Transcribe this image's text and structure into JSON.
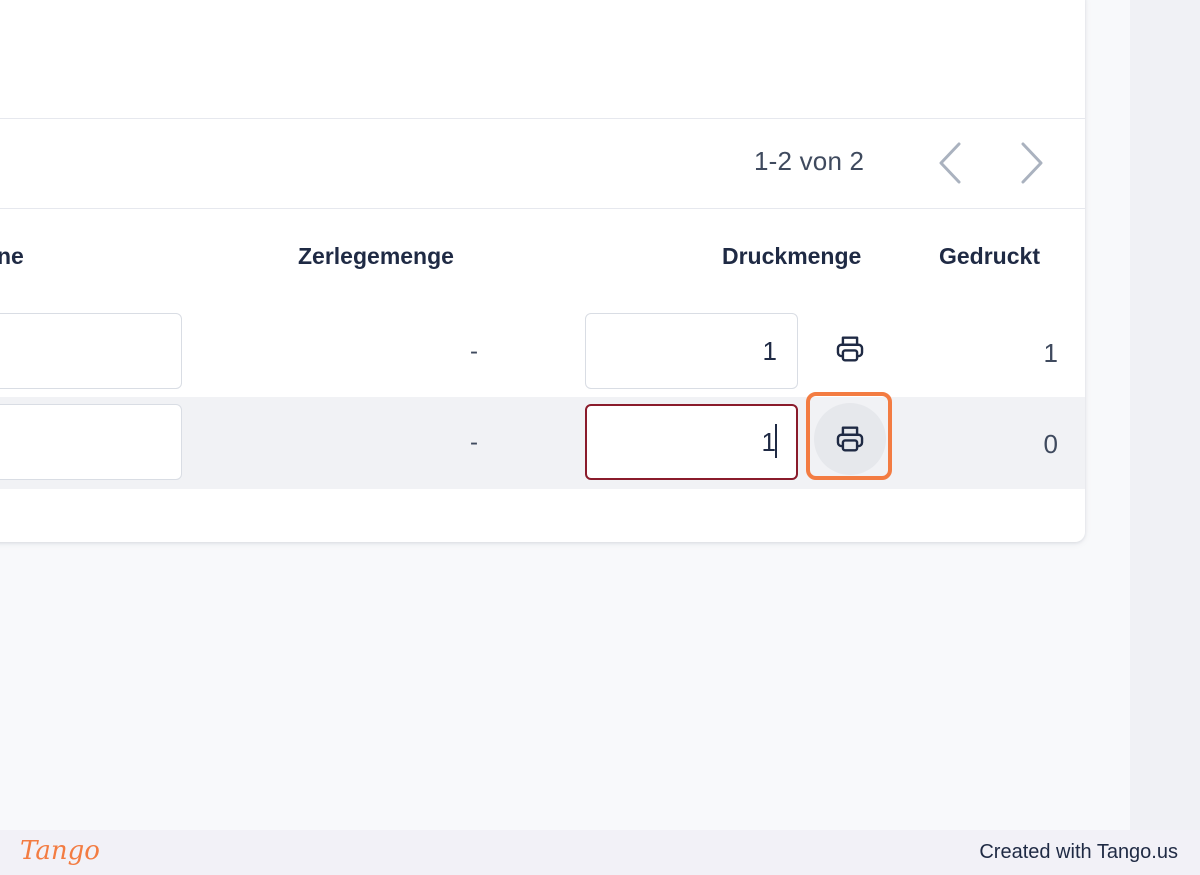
{
  "pagination": {
    "range_text": "1-2 von 2"
  },
  "columns": {
    "partial_header": "ne",
    "zerlegemenge": "Zerlegemenge",
    "druckmenge": "Druckmenge",
    "gedruckt": "Gedruckt"
  },
  "rows": [
    {
      "zerlegemenge": "-",
      "druckmenge": "1",
      "gedruckt": "1"
    },
    {
      "zerlegemenge": "-",
      "druckmenge": "1",
      "gedruckt": "0"
    }
  ],
  "icons": {
    "print": "printer-icon",
    "prev": "chevron-left-icon",
    "next": "chevron-right-icon"
  },
  "colors": {
    "focus_border": "#8a1b2b",
    "highlight": "#f37c42",
    "header_text": "#1f2a44"
  },
  "footer": {
    "logo": "Tango",
    "credit": "Created with Tango.us"
  }
}
